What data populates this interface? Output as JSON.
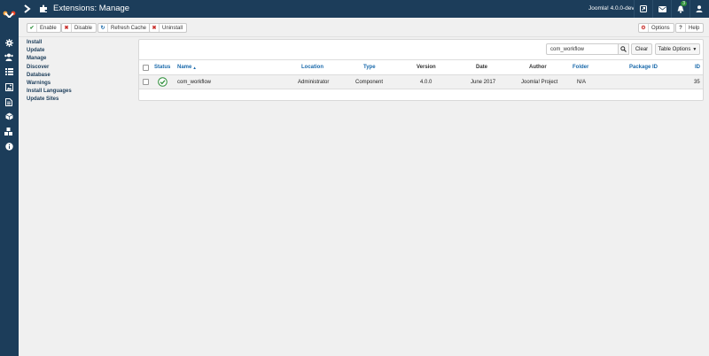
{
  "header": {
    "title": "Extensions: Manage",
    "version": "Joomla! 4.0.0-dev",
    "notification_count": "3"
  },
  "toolbar": {
    "enable": "Enable",
    "disable": "Disable",
    "refresh_cache": "Refresh Cache",
    "uninstall": "Uninstall",
    "options": "Options",
    "help": "Help"
  },
  "subnav": {
    "items": [
      "Install",
      "Update",
      "Manage",
      "Discover",
      "Database",
      "Warnings",
      "Install Languages",
      "Update Sites"
    ]
  },
  "search": {
    "value": "com_workflow",
    "clear_label": "Clear",
    "table_options_label": "Table Options"
  },
  "table": {
    "columns": {
      "status": "Status",
      "name": "Name",
      "location": "Location",
      "type": "Type",
      "version": "Version",
      "date": "Date",
      "author": "Author",
      "folder": "Folder",
      "package_id": "Package ID",
      "id": "ID"
    },
    "rows": [
      {
        "name": "com_workflow",
        "location": "Administrator",
        "type": "Component",
        "version": "4.0.0",
        "date": "June 2017",
        "author": "Joomla! Project",
        "folder": "N/A",
        "package_id": "",
        "id": "35"
      }
    ]
  },
  "colors": {
    "navy": "#1c3d5a",
    "link": "#1a6aab",
    "success": "#2f8f3b",
    "danger": "#c9302c"
  }
}
